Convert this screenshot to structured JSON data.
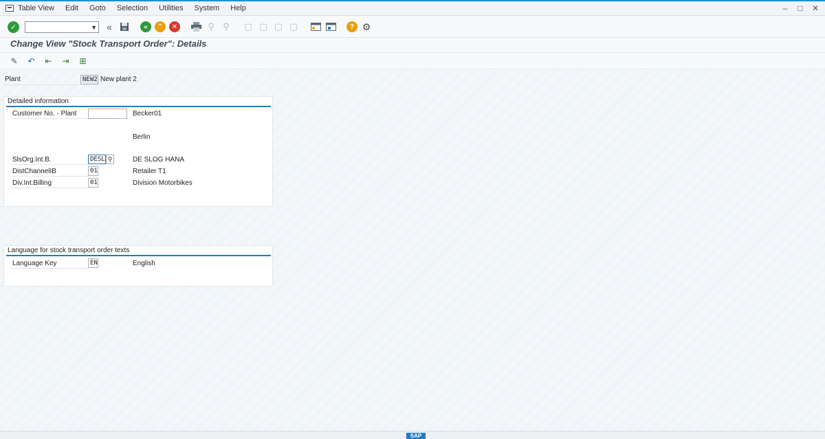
{
  "menu": {
    "items": [
      {
        "label": "Table View"
      },
      {
        "label": "Edit"
      },
      {
        "label": "Goto"
      },
      {
        "label": "Selection"
      },
      {
        "label": "Utilities"
      },
      {
        "label": "System"
      },
      {
        "label": "Help"
      }
    ]
  },
  "toolbar": {
    "command_value": ""
  },
  "page": {
    "title": "Change View \"Stock Transport Order\": Details"
  },
  "plant": {
    "label": "Plant",
    "value": "NEW2",
    "description": "New plant 2"
  },
  "detailed": {
    "title": "Detailed information",
    "customer_label": "Customer No. - Plant",
    "customer_value": "",
    "customer_desc1": "Becker01",
    "customer_desc2": "Berlin",
    "salesorg_label": "SlsOrg.Int.B.",
    "salesorg_value": "DESL",
    "salesorg_desc": "DE SLOG HANA",
    "distchannel_label": "DistChannelIB",
    "distchannel_value": "01",
    "distchannel_desc": "Retailer T1",
    "division_label": "Div.Int.Billing",
    "division_value": "01",
    "division_desc": "Division Motorbikes"
  },
  "language": {
    "title": "Language for stock transport order texts",
    "key_label": "Language Key",
    "key_value": "EN",
    "key_desc": "English"
  },
  "status": {
    "logo": "SAP"
  },
  "icons": {
    "ok": "check-icon",
    "save": "save-icon",
    "back": "back-icon",
    "exit": "exit-icon",
    "cancel": "cancel-icon",
    "print": "print-icon",
    "help": "help-icon",
    "settings": "gear-icon"
  },
  "colors": {
    "accent": "#2a7ab0",
    "ok_green": "#2e9a3a",
    "exit_orange": "#e8a00f",
    "cancel_red": "#d33a2c"
  }
}
